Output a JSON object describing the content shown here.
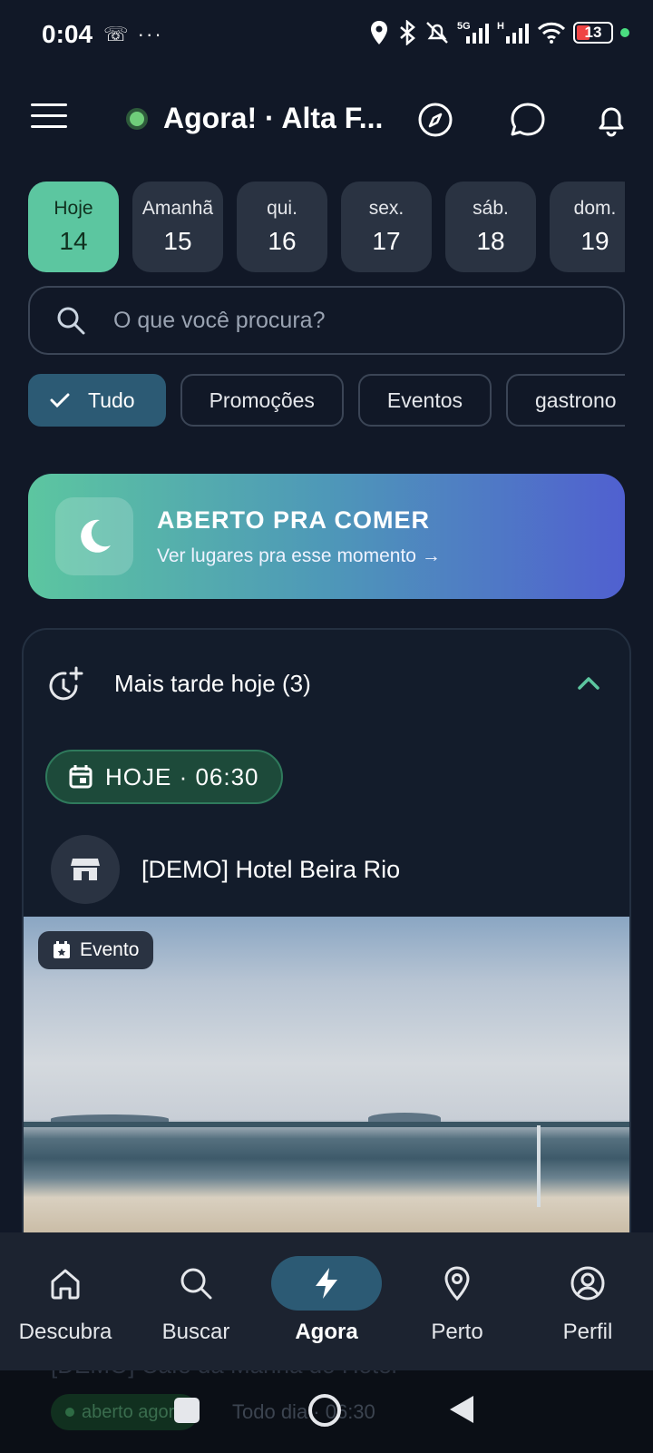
{
  "status_bar": {
    "time": "0:04",
    "left_icons": "☏ ···",
    "network": "5G",
    "network2": "H",
    "battery": "13"
  },
  "header": {
    "title": "Agora! · Alta F..."
  },
  "days": [
    {
      "name": "Hoje",
      "num": "14"
    },
    {
      "name": "Amanhã",
      "num": "15"
    },
    {
      "name": "qui.",
      "num": "16"
    },
    {
      "name": "sex.",
      "num": "17"
    },
    {
      "name": "sáb.",
      "num": "18"
    },
    {
      "name": "dom.",
      "num": "19"
    }
  ],
  "search": {
    "placeholder": "O que você procura?"
  },
  "filters": [
    {
      "label": "Tudo",
      "selected": true
    },
    {
      "label": "Promoções",
      "selected": false
    },
    {
      "label": "Eventos",
      "selected": false
    },
    {
      "label": "gastrono",
      "selected": false
    }
  ],
  "banner": {
    "title": "ABERTO PRA COMER",
    "subtitle": "Ver lugares pra esse momento →"
  },
  "section": {
    "title": "Mais tarde hoje (3)",
    "time_pill": "HOJE · 06:30",
    "venue_name": "[DEMO] Hotel Beira Rio",
    "badge": "Evento"
  },
  "peek": {
    "title": "[DEMO] Café da Manhã do Hotel",
    "status": "aberto agora",
    "meta": "Todo dia · 06:30"
  },
  "bottom_nav": [
    {
      "label": "Descubra",
      "icon": "home-icon"
    },
    {
      "label": "Buscar",
      "icon": "search-icon"
    },
    {
      "label": "Agora",
      "icon": "bolt-icon",
      "active": true
    },
    {
      "label": "Perto",
      "icon": "map-pin-icon"
    },
    {
      "label": "Perfil",
      "icon": "user-circle-icon"
    }
  ],
  "colors": {
    "background": "#111827",
    "accent_green": "#5cc6a0",
    "accent_blue": "#2c5a74",
    "banner_end": "#5060d0"
  }
}
